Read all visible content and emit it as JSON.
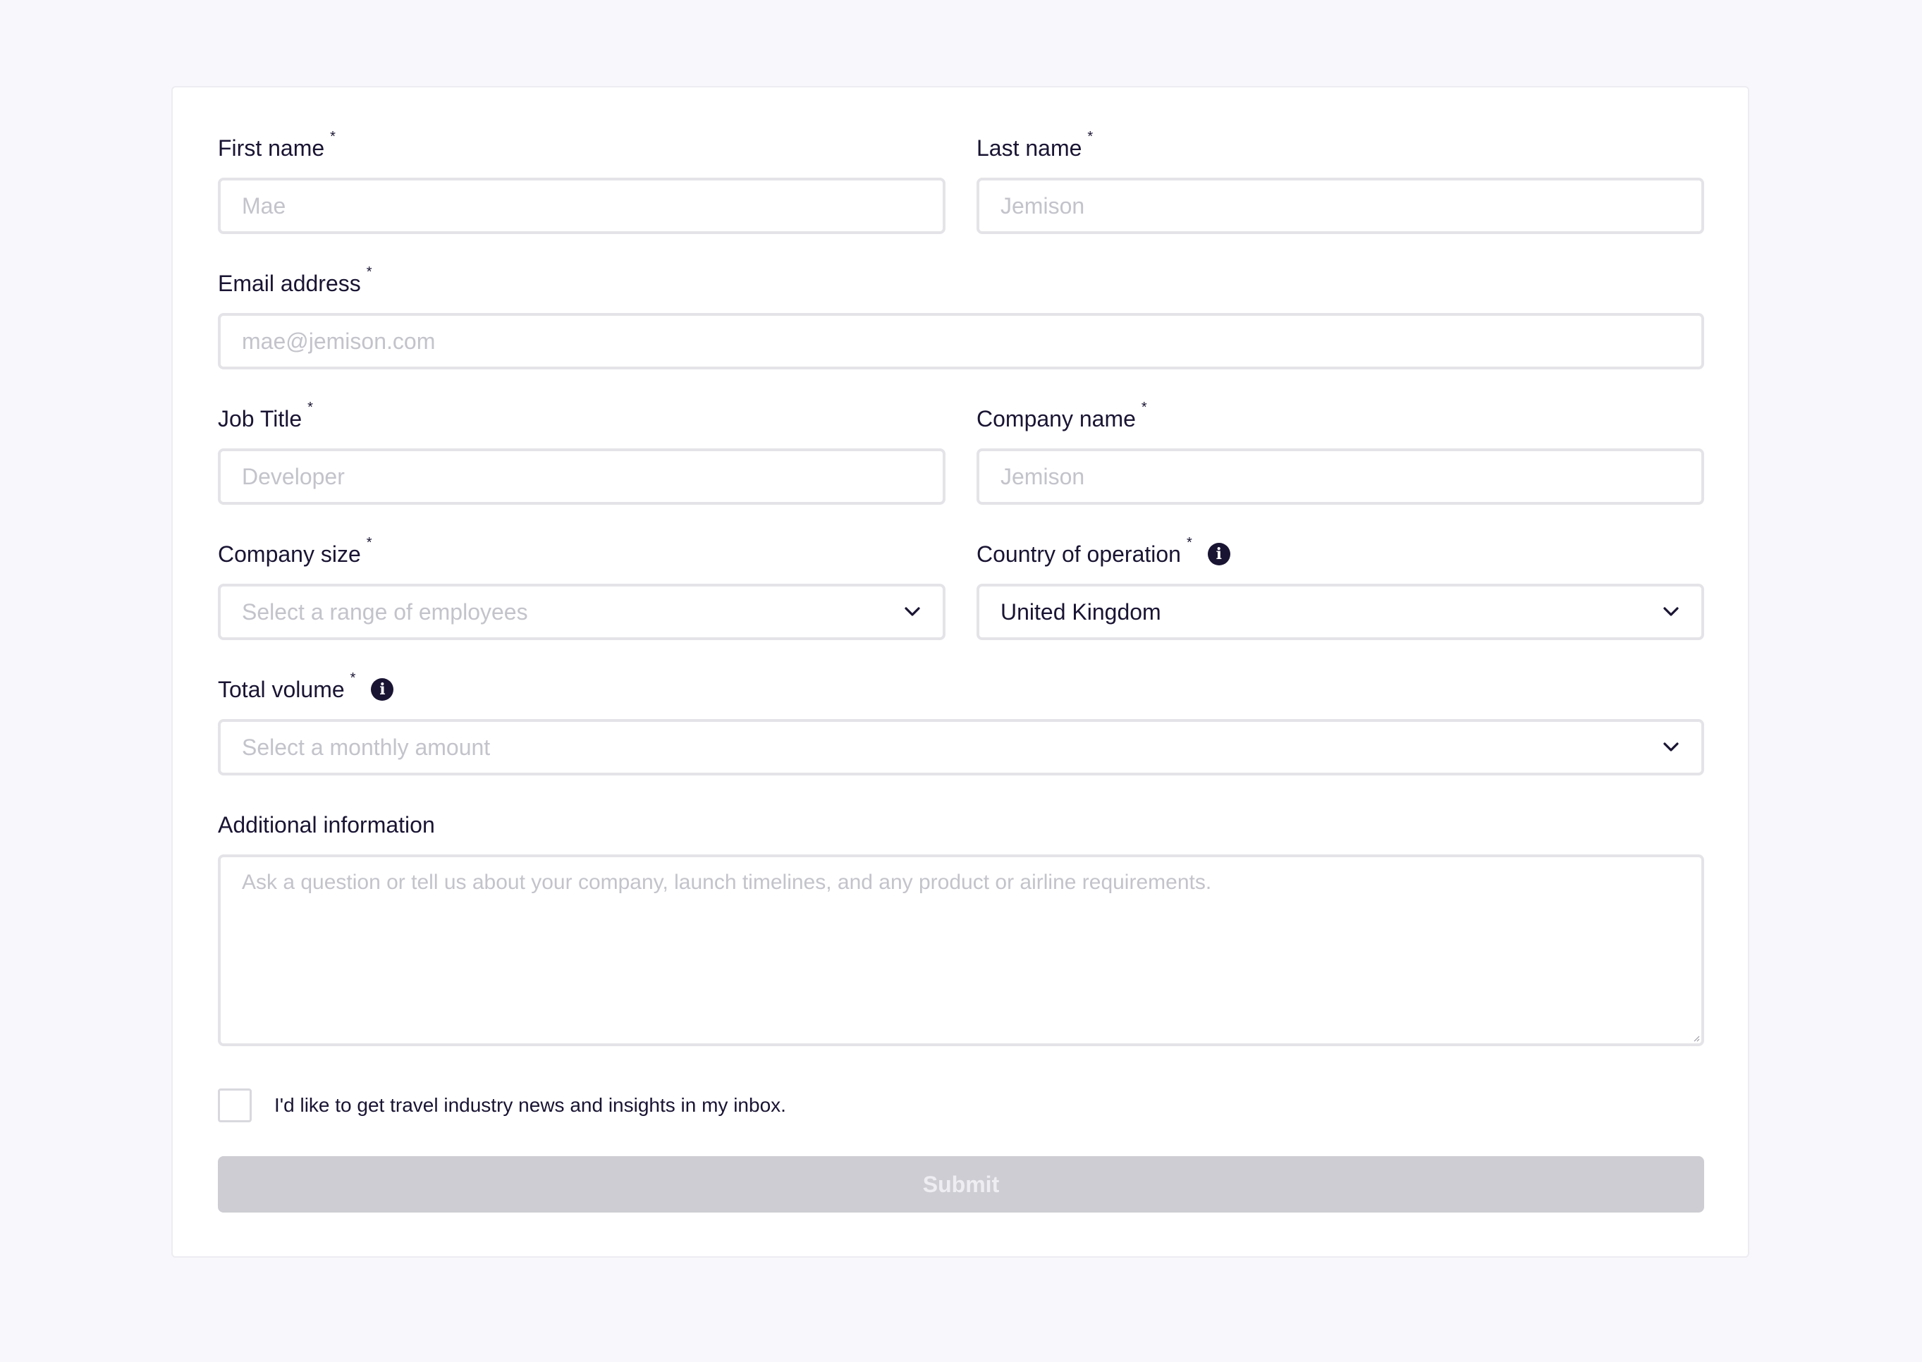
{
  "form": {
    "first_name": {
      "label": "First name",
      "required": "*",
      "placeholder": "Mae"
    },
    "last_name": {
      "label": "Last name",
      "required": "*",
      "placeholder": "Jemison"
    },
    "email": {
      "label": "Email address",
      "required": "*",
      "placeholder": "mae@jemison.com"
    },
    "job_title": {
      "label": "Job Title",
      "required": "*",
      "placeholder": "Developer"
    },
    "company_name": {
      "label": "Company name",
      "required": "*",
      "placeholder": "Jemison"
    },
    "company_size": {
      "label": "Company size",
      "required": "*",
      "placeholder": "Select a range of employees"
    },
    "country": {
      "label": "Country of operation",
      "required": "*",
      "info_icon": "i",
      "value": "United Kingdom"
    },
    "total_volume": {
      "label": "Total volume",
      "required": "*",
      "info_icon": "i",
      "placeholder": "Select a monthly amount"
    },
    "additional_info": {
      "label": "Additional information",
      "placeholder": "Ask a question or tell us about your company, launch timelines, and any product or airline requirements."
    },
    "newsletter": {
      "label": "I'd like to get travel industry news and insights in my inbox.",
      "checked": false
    },
    "submit_label": "Submit"
  },
  "colors": {
    "page_background": "#f8f8fc",
    "card_background": "#ffffff",
    "text": "#1a1433",
    "placeholder": "#c3c3cb",
    "input_border": "#e4e4e8",
    "submit_disabled": "#cdcdd3"
  },
  "icons": {
    "info": "info-icon",
    "chevron": "chevron-down-icon",
    "checkbox": "checkbox-icon"
  }
}
